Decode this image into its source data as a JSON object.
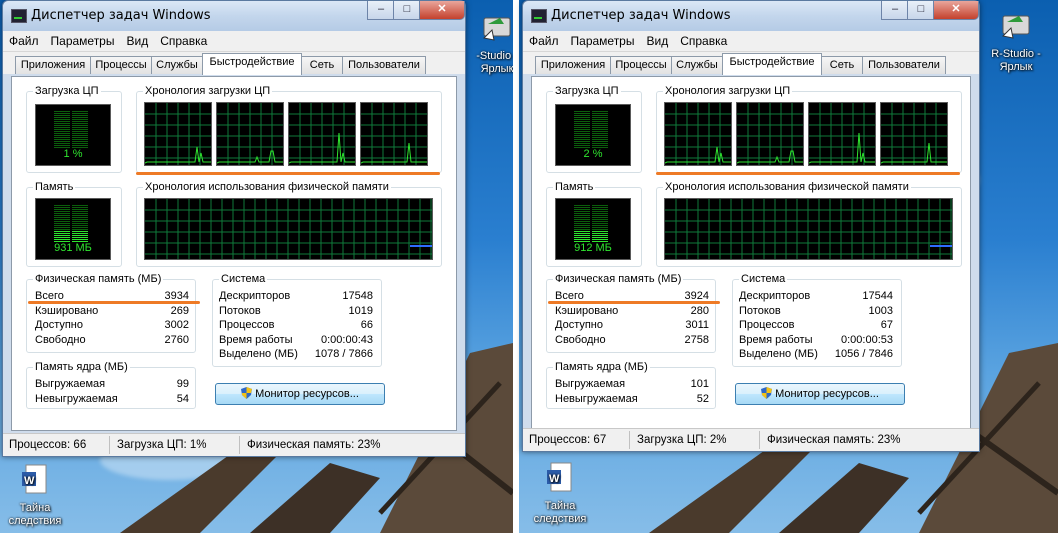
{
  "desktop": {
    "icon_rstudio_label": "R-Studio - Ярлык",
    "icon_doc_label": "Тайна следствия",
    "icon_rstudio_label_left": "-Studio - Ярлык"
  },
  "windows": [
    {
      "title": "Диспетчер задач Windows",
      "menu": [
        "Файл",
        "Параметры",
        "Вид",
        "Справка"
      ],
      "tabs": [
        "Приложения",
        "Процессы",
        "Службы",
        "Быстродействие",
        "Сеть",
        "Пользователи"
      ],
      "active_tab": 3,
      "cpu_usage_label": "Загрузка ЦП",
      "cpu_usage_value": "1 %",
      "cpu_history_label": "Хронология загрузки ЦП",
      "memory_label": "Память",
      "memory_value": "931 МБ",
      "memory_history_label": "Хронология использования физической памяти",
      "physical_memory": {
        "title": "Физическая память (МБ)",
        "rows": [
          {
            "k": "Всего",
            "v": "3934"
          },
          {
            "k": "Кэшировано",
            "v": "269"
          },
          {
            "k": "Доступно",
            "v": "3002"
          },
          {
            "k": "Свободно",
            "v": "2760"
          }
        ]
      },
      "kernel_memory": {
        "title": "Память ядра (МБ)",
        "rows": [
          {
            "k": "Выгружаемая",
            "v": "99"
          },
          {
            "k": "Невыгружаемая",
            "v": "54"
          }
        ]
      },
      "system": {
        "title": "Система",
        "rows": [
          {
            "k": "Дескрипторов",
            "v": "17548"
          },
          {
            "k": "Потоков",
            "v": "1019"
          },
          {
            "k": "Процессов",
            "v": "66"
          },
          {
            "k": "Время работы",
            "v": "0:00:00:43"
          },
          {
            "k": "Выделено (МБ)",
            "v": "1078 / 7866"
          }
        ]
      },
      "resource_monitor_button": "Монитор ресурсов...",
      "status": {
        "processes": "Процессов: 66",
        "cpu": "Загрузка ЦП: 1%",
        "memory": "Физическая память: 23%"
      }
    },
    {
      "title": "Диспетчер задач Windows",
      "menu": [
        "Файл",
        "Параметры",
        "Вид",
        "Справка"
      ],
      "tabs": [
        "Приложения",
        "Процессы",
        "Службы",
        "Быстродействие",
        "Сеть",
        "Пользователи"
      ],
      "active_tab": 3,
      "cpu_usage_label": "Загрузка ЦП",
      "cpu_usage_value": "2 %",
      "cpu_history_label": "Хронология загрузки ЦП",
      "memory_label": "Память",
      "memory_value": "912 МБ",
      "memory_history_label": "Хронология использования физической памяти",
      "physical_memory": {
        "title": "Физическая память (МБ)",
        "rows": [
          {
            "k": "Всего",
            "v": "3924"
          },
          {
            "k": "Кэшировано",
            "v": "280"
          },
          {
            "k": "Доступно",
            "v": "3011"
          },
          {
            "k": "Свободно",
            "v": "2758"
          }
        ]
      },
      "kernel_memory": {
        "title": "Память ядра (МБ)",
        "rows": [
          {
            "k": "Выгружаемая",
            "v": "101"
          },
          {
            "k": "Невыгружаемая",
            "v": "52"
          }
        ]
      },
      "system": {
        "title": "Система",
        "rows": [
          {
            "k": "Дескрипторов",
            "v": "17544"
          },
          {
            "k": "Потоков",
            "v": "1003"
          },
          {
            "k": "Процессов",
            "v": "67"
          },
          {
            "k": "Время работы",
            "v": "0:00:00:53"
          },
          {
            "k": "Выделено (МБ)",
            "v": "1056 / 7846"
          }
        ]
      },
      "resource_monitor_button": "Монитор ресурсов...",
      "status": {
        "processes": "Процессов: 67",
        "cpu": "Загрузка ЦП: 2%",
        "memory": "Физическая память: 23%"
      }
    }
  ],
  "colors": {
    "graph_green": "#2fe52f",
    "grid_green": "#0f7a3a",
    "memory_line_blue": "#2e6cff",
    "highlight_orange": "#ee7a26"
  }
}
